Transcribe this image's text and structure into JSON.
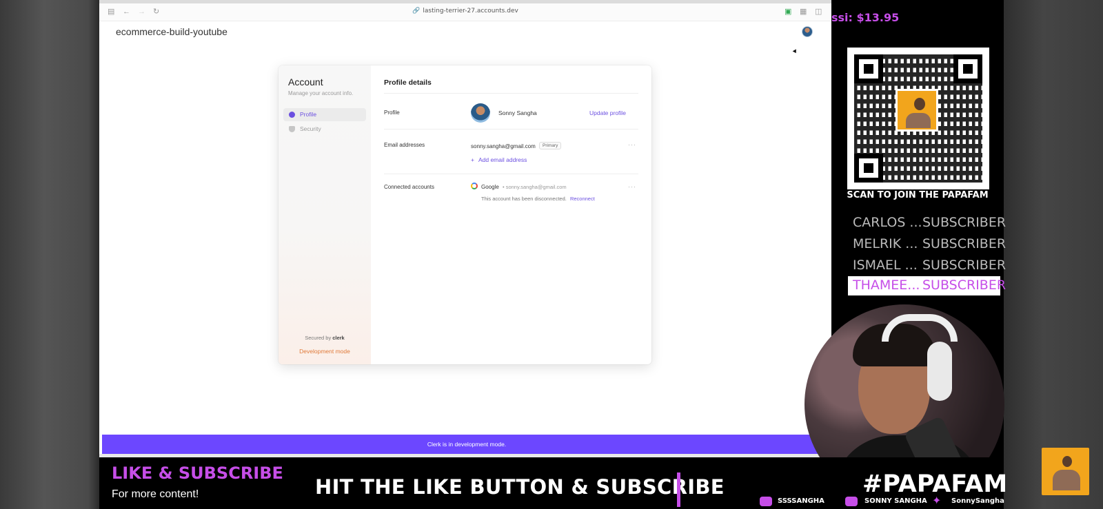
{
  "browser": {
    "url": "lasting-terrier-27.accounts.dev",
    "app_title": "ecommerce-build-youtube",
    "banner": "Clerk is in development mode."
  },
  "account": {
    "title": "Account",
    "subtitle": "Manage your account info.",
    "nav": {
      "profile": "Profile",
      "security": "Security"
    },
    "secured_by": "Secured by",
    "secured_brand": "clerk",
    "dev_mode": "Development mode",
    "profile_details": {
      "title": "Profile details",
      "profile_label": "Profile",
      "name": "Sonny Sangha",
      "update_link": "Update profile",
      "email_label": "Email addresses",
      "email": "sonny.sangha@gmail.com",
      "primary_badge": "Primary",
      "add_email": "Add email address",
      "connected_label": "Connected accounts",
      "provider": "Google",
      "provider_email": "• sonny.sangha@gmail.com",
      "disconnected_msg": "This account has been disconnected.",
      "reconnect": "Reconnect",
      "more_label": "···"
    }
  },
  "overlay": {
    "donation": "ssi: $13.95",
    "qr_caption": "SCAN TO JOIN THE PAPAFAM",
    "subscribers": [
      {
        "name": "CARLOS ...",
        "tier": "SUBSCRIBER"
      },
      {
        "name": "MELRIK ...",
        "tier": "SUBSCRIBER"
      },
      {
        "name": "ISMAEL ...",
        "tier": "SUBSCRIBER"
      },
      {
        "name": "THAMEE...",
        "tier": "SUBSCRIBER"
      }
    ],
    "like_title": "LIKE & SUBSCRIBE",
    "like_sub": "For more content!",
    "hit_text": "HIT THE LIKE BUTTON & SUBSCRIBE",
    "hashtag": "#PAPAFAM",
    "socials": {
      "instagram": "SSSSANGHA",
      "youtube": "SONNY SANGHA",
      "twitter": "SonnySangha"
    }
  },
  "colors": {
    "accent": "#6c47ff",
    "overlay_purple": "#c64ee8",
    "dev_orange": "#e07a3a"
  }
}
